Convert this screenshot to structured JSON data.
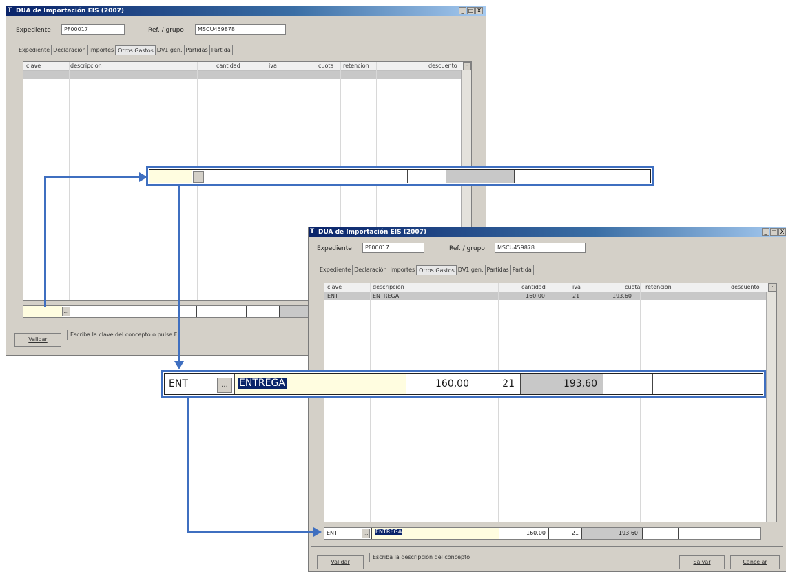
{
  "window_title": "DUA de Importación EIS (2007)",
  "title_buttons": [
    "_",
    "□",
    "X"
  ],
  "fields": {
    "expediente_label": "Expediente",
    "expediente_value": "PF00017",
    "ref_label": "Ref. / grupo",
    "ref_value": "MSCU459878"
  },
  "tabs": [
    "Expediente",
    "Declaración",
    "Importes",
    "Otros Gastos",
    "DV1 gen.",
    "Partidas",
    "Partida"
  ],
  "active_tab": "Otros Gastos",
  "columns": [
    "clave",
    "descripcion",
    "cantidad",
    "iva",
    "cuota",
    "retencion",
    "descuento"
  ],
  "back_window": {
    "validate_button": "Validar",
    "status_text": "Escriba la clave del concepto o pulse F3",
    "ellipsis": "..."
  },
  "front_window": {
    "row": {
      "clave": "ENT",
      "descripcion": "ENTREGA",
      "cantidad": "160,00",
      "iva": "21",
      "cuota": "193,60"
    },
    "validate_button": "Validar",
    "status_text": "Escriba la descripción del concepto",
    "save_button": "Salvar",
    "cancel_button": "Cancelar",
    "edit": {
      "clave": "ENT",
      "ellipsis": "...",
      "descripcion": "ENTREGA",
      "cantidad": "160,00",
      "iva": "21",
      "cuota": "193,60"
    }
  },
  "zoom_row_empty": {
    "ellipsis": "..."
  },
  "zoom_row_filled": {
    "clave": "ENT",
    "ellipsis": "...",
    "descripcion": "ENTREGA",
    "cantidad": "160,00",
    "iva": "21",
    "cuota": "193,60"
  },
  "colors": {
    "highlight": "#0a246a",
    "connector": "#3f6fc0",
    "entry_yellow": "#fffde0",
    "window_face": "#d4d0c8"
  }
}
